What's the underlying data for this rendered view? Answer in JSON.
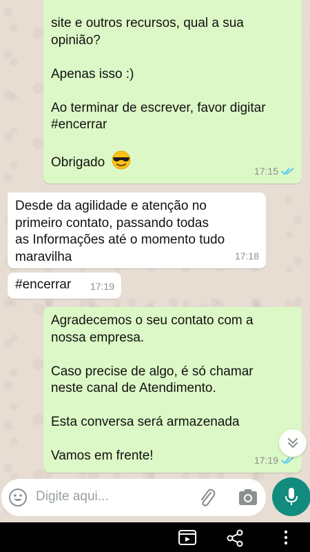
{
  "header": {
    "logo_fragment": ""
  },
  "messages": [
    {
      "direction": "outgoing",
      "lines": [
        "site e outros recursos, qual a sua",
        "opinião?",
        "",
        "Apenas isso :)",
        "",
        "Ao terminar de escrever, favor digitar",
        "#encerrar",
        "",
        "Obrigado"
      ],
      "emoji": "smiling-face-with-sunglasses",
      "time": "17:15",
      "status": "read"
    },
    {
      "direction": "incoming",
      "lines": [
        "Desde da agilidade e atenção no",
        "primeiro contato, passando todas",
        "as Informações até o momento tudo",
        "maravilha"
      ],
      "time": "17:18"
    },
    {
      "direction": "incoming",
      "lines": [
        "#encerrar"
      ],
      "time": "17:19"
    },
    {
      "direction": "outgoing",
      "lines": [
        "Agradecemos o seu contato com a",
        "nossa empresa.",
        "",
        "Caso precise de algo, é só chamar",
        "neste canal de Atendimento.",
        "",
        "Esta conversa será armazenada",
        "",
        "Vamos em frente!"
      ],
      "time": "17:19",
      "status": "read"
    }
  ],
  "composer": {
    "placeholder": "Digite aqui...",
    "icons": [
      "emoji-icon",
      "paperclip-icon",
      "camera-icon",
      "microphone-icon"
    ]
  },
  "colors": {
    "outgoing_bubble": "#dcf8c6",
    "incoming_bubble": "#ffffff",
    "read_ticks": "#4fc3f7",
    "mic_button": "#128c7e",
    "wallpaper": "#e7ddd3"
  },
  "system_bar": {
    "icons": [
      "media-icon",
      "share-icon",
      "more-vert-icon"
    ]
  }
}
